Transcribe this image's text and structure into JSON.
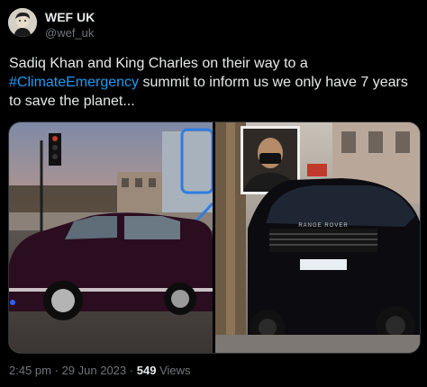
{
  "account": {
    "name": "WEF UK",
    "handle": "@wef_uk"
  },
  "tweet": {
    "text_part1": "Sadiq Khan and King Charles on their way to a",
    "hashtag": "#ClimateEmergency",
    "text_part2": "summit to inform us we only have 7 years to save the planet..."
  },
  "media": {
    "left_photo": "bentley-state-limousine",
    "right_photo": "range-rover-with-inset-portrait",
    "plate_text": "RANGE ROVER"
  },
  "meta": {
    "time": "2:45 pm",
    "date": "29 Jun 2023",
    "views_count": "549",
    "views_label": "Views"
  },
  "colors": {
    "background": "#000000",
    "text": "#e7e9ea",
    "muted": "#71767b",
    "link": "#1d9bf0"
  }
}
